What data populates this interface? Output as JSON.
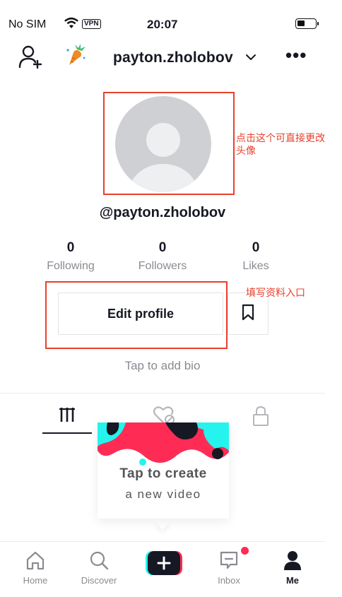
{
  "status_bar": {
    "carrier": "No SIM",
    "vpn": "VPN",
    "time": "20:07",
    "battery_level": 0.45
  },
  "header": {
    "username": "payton.zholobov",
    "icons": [
      "add-user-icon",
      "carrot-icon",
      "chevron-down-icon",
      "more-icon"
    ]
  },
  "profile": {
    "handle": "@payton.zholobov",
    "avatar_note": "点击这个可直接更改头像"
  },
  "stats": [
    {
      "value": "0",
      "label": "Following"
    },
    {
      "value": "0",
      "label": "Followers"
    },
    {
      "value": "0",
      "label": "Likes"
    }
  ],
  "actions": {
    "edit_profile": "Edit profile",
    "edit_note": "填写资料入口",
    "bio_placeholder": "Tap to add bio"
  },
  "tabs": [
    "videos-grid-icon",
    "liked-icon",
    "private-lock-icon"
  ],
  "create_card": {
    "title": "Tap to create",
    "subtitle": "a new video"
  },
  "nav": {
    "home": "Home",
    "discover": "Discover",
    "inbox": "Inbox",
    "me": "Me"
  },
  "colors": {
    "annotation_red": "#e8402c",
    "tiktok_pink": "#fe2c55",
    "tiktok_cyan": "#25f4ee",
    "text_dark": "#161823",
    "text_grey": "#8a8b91"
  }
}
